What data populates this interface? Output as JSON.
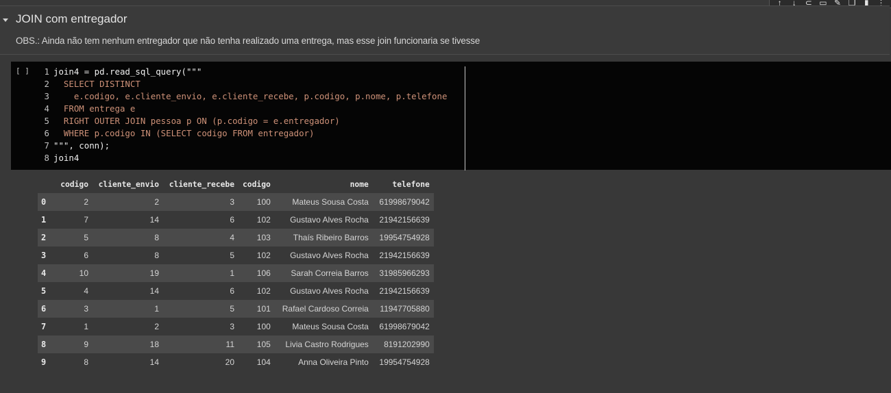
{
  "toolbar": {
    "icons": [
      "arrow-up-icon",
      "arrow-down-icon",
      "link-icon",
      "comment-icon",
      "edit-icon",
      "copy-icon",
      "delete-icon",
      "more-icon"
    ]
  },
  "text_cell": {
    "heading": "JOIN com entregador",
    "obs": "OBS.: Ainda não tem nenhum entregador que não tenha realizado uma entrega, mas esse join funcionaria se tivesse"
  },
  "code_cell": {
    "run_indicator": "[ ]",
    "lines": [
      {
        "num": "1",
        "text": "join4 = pd.read_sql_query(\"\"\"",
        "sql": false
      },
      {
        "num": "2",
        "text": "  SELECT DISTINCT",
        "sql": true
      },
      {
        "num": "3",
        "text": "    e.codigo, e.cliente_envio, e.cliente_recebe, p.codigo, p.nome, p.telefone",
        "sql": true
      },
      {
        "num": "4",
        "text": "  FROM entrega e",
        "sql": true
      },
      {
        "num": "5",
        "text": "  RIGHT OUTER JOIN pessoa p ON (p.codigo = e.entregador)",
        "sql": true
      },
      {
        "num": "6",
        "text": "  WHERE p.codigo IN (SELECT codigo FROM entregador)",
        "sql": true
      },
      {
        "num": "7",
        "text": "\"\"\", conn);",
        "sql": false
      },
      {
        "num": "8",
        "text": "join4",
        "sql": false
      }
    ]
  },
  "output_table": {
    "columns": [
      "",
      "codigo",
      "cliente_envio",
      "cliente_recebe",
      "codigo",
      "nome",
      "telefone"
    ],
    "rows": [
      [
        "0",
        "2",
        "2",
        "3",
        "100",
        "Mateus Sousa Costa",
        "61998679042"
      ],
      [
        "1",
        "7",
        "14",
        "6",
        "102",
        "Gustavo Alves Rocha",
        "21942156639"
      ],
      [
        "2",
        "5",
        "8",
        "4",
        "103",
        "Thaís Ribeiro Barros",
        "19954754928"
      ],
      [
        "3",
        "6",
        "8",
        "5",
        "102",
        "Gustavo Alves Rocha",
        "21942156639"
      ],
      [
        "4",
        "10",
        "19",
        "1",
        "106",
        "Sarah Correia Barros",
        "31985966293"
      ],
      [
        "5",
        "4",
        "14",
        "6",
        "102",
        "Gustavo Alves Rocha",
        "21942156639"
      ],
      [
        "6",
        "3",
        "1",
        "5",
        "101",
        "Rafael Cardoso Correia",
        "11947705880"
      ],
      [
        "7",
        "1",
        "2",
        "3",
        "100",
        "Mateus Sousa Costa",
        "61998679042"
      ],
      [
        "8",
        "9",
        "18",
        "11",
        "105",
        "Livia Castro Rodrigues",
        "8191202990"
      ],
      [
        "9",
        "8",
        "14",
        "20",
        "104",
        "Anna Oliveira Pinto",
        "19954754928"
      ]
    ]
  }
}
